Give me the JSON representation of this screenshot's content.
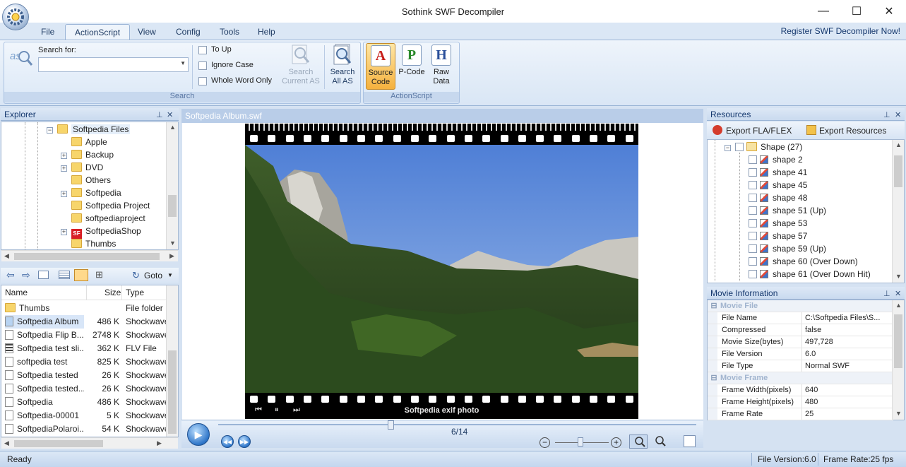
{
  "window": {
    "title": "Sothink SWF Decompiler",
    "minimize": "—",
    "maximize": "☐",
    "close": "✕"
  },
  "menu": {
    "tabs": [
      "File",
      "ActionScript",
      "View",
      "Config",
      "Tools",
      "Help"
    ],
    "active_tab": "ActionScript",
    "register_link": "Register SWF Decompiler Now!"
  },
  "ribbon": {
    "search_group": {
      "label": "Search",
      "search_for_label": "Search for:",
      "search_value": "",
      "to_up": "To Up",
      "ignore_case": "Ignore Case",
      "whole_word": "Whole Word Only",
      "search_current_line1": "Search",
      "search_current_line2": "Current AS",
      "search_all_line1": "Search",
      "search_all_line2": "All AS"
    },
    "as_group": {
      "label": "ActionScript",
      "source_code_line1": "Source",
      "source_code_line2": "Code",
      "pcode": "P-Code",
      "raw_line1": "Raw",
      "raw_line2": "Data"
    }
  },
  "explorer": {
    "title": "Explorer",
    "pin": "📌",
    "close": "✕",
    "tree": [
      {
        "label": "Softpedia Files",
        "expander": "−",
        "level": 0,
        "selected": true
      },
      {
        "label": "Apple",
        "expander": "",
        "level": 1
      },
      {
        "label": "Backup",
        "expander": "+",
        "level": 1
      },
      {
        "label": "DVD",
        "expander": "+",
        "level": 1
      },
      {
        "label": "Others",
        "expander": "",
        "level": 1
      },
      {
        "label": "Softpedia",
        "expander": "+",
        "level": 1
      },
      {
        "label": "Softpedia Project",
        "expander": "",
        "level": 1
      },
      {
        "label": "softpediaproject",
        "expander": "",
        "level": 1
      },
      {
        "label": "SoftpediaShop",
        "expander": "+",
        "level": 1,
        "special": true
      },
      {
        "label": "Thumbs",
        "expander": "",
        "level": 1
      }
    ],
    "toolbar_goto": "Goto",
    "columns": {
      "name": "Name",
      "size": "Size",
      "type": "Type"
    },
    "files": [
      {
        "name": "Thumbs",
        "size": "",
        "type": "File folder",
        "kind": "folder"
      },
      {
        "name": "Softpedia Album",
        "size": "486 K",
        "type": "Shockwave",
        "kind": "swf",
        "selected": true
      },
      {
        "name": "Softpedia Flip B...",
        "size": "2748 K",
        "type": "Shockwave",
        "kind": "swf"
      },
      {
        "name": "Softpedia test sli...",
        "size": "362 K",
        "type": "FLV File",
        "kind": "flv"
      },
      {
        "name": "softpedia test",
        "size": "825 K",
        "type": "Shockwave",
        "kind": "swf"
      },
      {
        "name": "Softpedia tested",
        "size": "26 K",
        "type": "Shockwave",
        "kind": "swf"
      },
      {
        "name": "Softpedia tested...",
        "size": "26 K",
        "type": "Shockwave",
        "kind": "swf"
      },
      {
        "name": "Softpedia",
        "size": "486 K",
        "type": "Shockwave",
        "kind": "swf"
      },
      {
        "name": "Softpedia-00001",
        "size": "5 K",
        "type": "Shockwave",
        "kind": "swf"
      },
      {
        "name": "SoftpediaPolaroi...",
        "size": "54 K",
        "type": "Shockwave",
        "kind": "swf"
      }
    ]
  },
  "document": {
    "tab_title": "Softpedia Album.swf",
    "caption": "Softpedia exif photo",
    "frame_counter": "6/14",
    "playback_fraction": 0.36
  },
  "resources": {
    "title": "Resources",
    "export_fla": "Export FLA/FLEX",
    "export_resources": "Export Resources",
    "group": "Shape (27)",
    "items": [
      "shape 2",
      "shape 41",
      "shape 45",
      "shape 48",
      "shape 51 (Up)",
      "shape 53",
      "shape 57",
      "shape 59 (Up)",
      "shape 60 (Over Down)",
      "shape 61 (Over Down Hit)"
    ]
  },
  "movie_info": {
    "title": "Movie Information",
    "rows": [
      {
        "category": "Movie File"
      },
      {
        "name": "File Name",
        "value": "C:\\Softpedia Files\\S..."
      },
      {
        "name": "Compressed",
        "value": "false"
      },
      {
        "name": "Movie Size(bytes)",
        "value": "497,728"
      },
      {
        "name": "File Version",
        "value": "6.0"
      },
      {
        "name": "File Type",
        "value": "Normal SWF"
      },
      {
        "category": "Movie Frame"
      },
      {
        "name": "Frame Width(pixels)",
        "value": "640"
      },
      {
        "name": "Frame Height(pixels)",
        "value": "480"
      },
      {
        "name": "Frame Rate",
        "value": "25"
      }
    ]
  },
  "status": {
    "left": "Ready",
    "file_version": "File Version:6.0",
    "frame_rate": "Frame Rate:25 fps"
  },
  "colors": {
    "ribbon_bg": "#dbe7f5",
    "accent": "#f5b13e",
    "panel_title": "#15386e"
  }
}
